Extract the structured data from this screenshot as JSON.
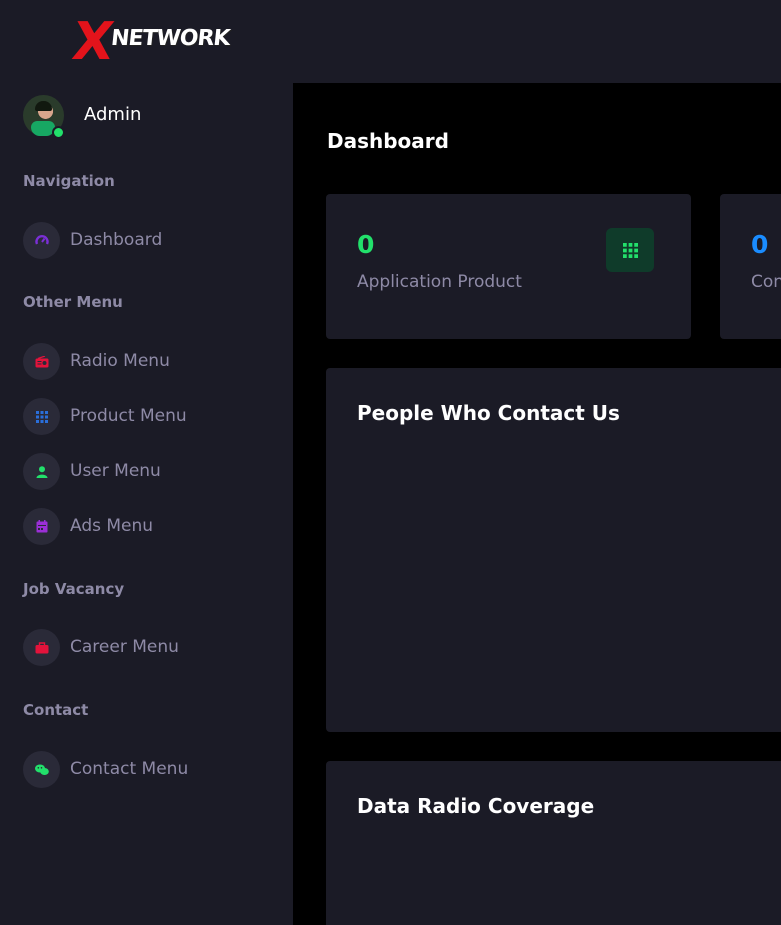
{
  "brand": {
    "logo_letter": "X",
    "logo_word": "NETWORK"
  },
  "user": {
    "name": "Admin"
  },
  "sidebar": {
    "sections": [
      {
        "label": "Navigation",
        "items": [
          {
            "label": "Dashboard",
            "icon": "speedometer-icon",
            "color": "#7b2fd6"
          }
        ]
      },
      {
        "label": "Other Menu",
        "items": [
          {
            "label": "Radio Menu",
            "icon": "radio-icon",
            "color": "#e3133b"
          },
          {
            "label": "Product Menu",
            "icon": "grid-icon",
            "color": "#2a6fdb"
          },
          {
            "label": "User Menu",
            "icon": "user-icon",
            "color": "#22e06b"
          },
          {
            "label": "Ads Menu",
            "icon": "calendar-icon",
            "color": "#9b2fd6"
          }
        ]
      },
      {
        "label": "Job Vacancy",
        "items": [
          {
            "label": "Career Menu",
            "icon": "briefcase-icon",
            "color": "#e3133b"
          }
        ]
      },
      {
        "label": "Contact",
        "items": [
          {
            "label": "Contact Menu",
            "icon": "wechat-icon",
            "color": "#22e06b"
          }
        ]
      }
    ]
  },
  "main": {
    "page_title": "Dashboard",
    "stats": [
      {
        "value": "0",
        "label": "Application Product",
        "color": "#22e06b",
        "icon": "grid-icon"
      },
      {
        "value": "0",
        "label": "Con",
        "color": "#1a8cff"
      }
    ],
    "panels": [
      {
        "title": "People Who Contact Us"
      },
      {
        "title": "Data Radio Coverage"
      }
    ]
  }
}
